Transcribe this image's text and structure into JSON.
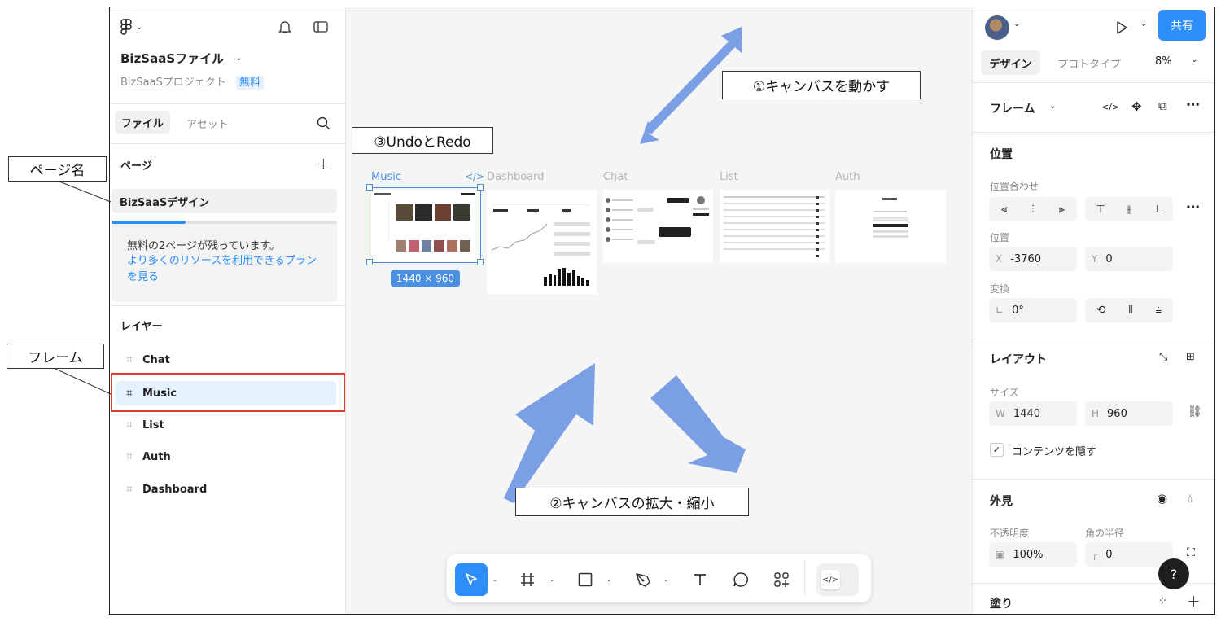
{
  "left_panel": {
    "file_name": "BizSaaSファイル",
    "project_name": "BizSaaSプロジェクト",
    "plan_badge": "無料",
    "tabs": [
      "ファイル",
      "アセット"
    ],
    "pages_heading": "ページ",
    "page_name": "BizSaaSデザイン",
    "page_limit_notice": "無料の2ページが残っています。",
    "upgrade_link": "より多くのリソースを利用できるプランを見る",
    "layers_heading": "レイヤー",
    "layers": [
      "Chat",
      "Music",
      "List",
      "Auth",
      "Dashboard"
    ]
  },
  "canvas": {
    "frame_labels": [
      "Music",
      "Dashboard",
      "Chat",
      "List",
      "Auth"
    ],
    "selection_size": "1440 × 960"
  },
  "annotations": {
    "move_canvas": "①キャンバスを動かす",
    "zoom_canvas": "②キャンバスの拡大・縮小",
    "undo_redo": "③UndoとRedo",
    "page_name": "ページ名",
    "frame": "フレーム"
  },
  "right_panel": {
    "share_button": "共有",
    "tabs": [
      "デザイン",
      "プロトタイプ"
    ],
    "zoom": "8%",
    "frame_heading": "フレーム",
    "position_heading": "位置",
    "alignment_label": "位置合わせ",
    "position_label": "位置",
    "x_label": "X",
    "x_value": "-3760",
    "y_label": "Y",
    "y_value": "0",
    "transform_label": "変換",
    "rotation_value": "0°",
    "layout_heading": "レイアウト",
    "size_label": "サイズ",
    "w_label": "W",
    "w_value": "1440",
    "h_label": "H",
    "h_value": "960",
    "clip_content_label": "コンテンツを隠す",
    "appearance_heading": "外見",
    "opacity_label": "不透明度",
    "opacity_value": "100%",
    "radius_label": "角の半径",
    "radius_value": "0",
    "fill_heading": "塗り",
    "help": "?"
  },
  "colors": {
    "accent": "#2c8ef8",
    "selection": "#4a90e2",
    "callout_highlight": "#e23c2c",
    "arrow": "#7a9fe4"
  }
}
